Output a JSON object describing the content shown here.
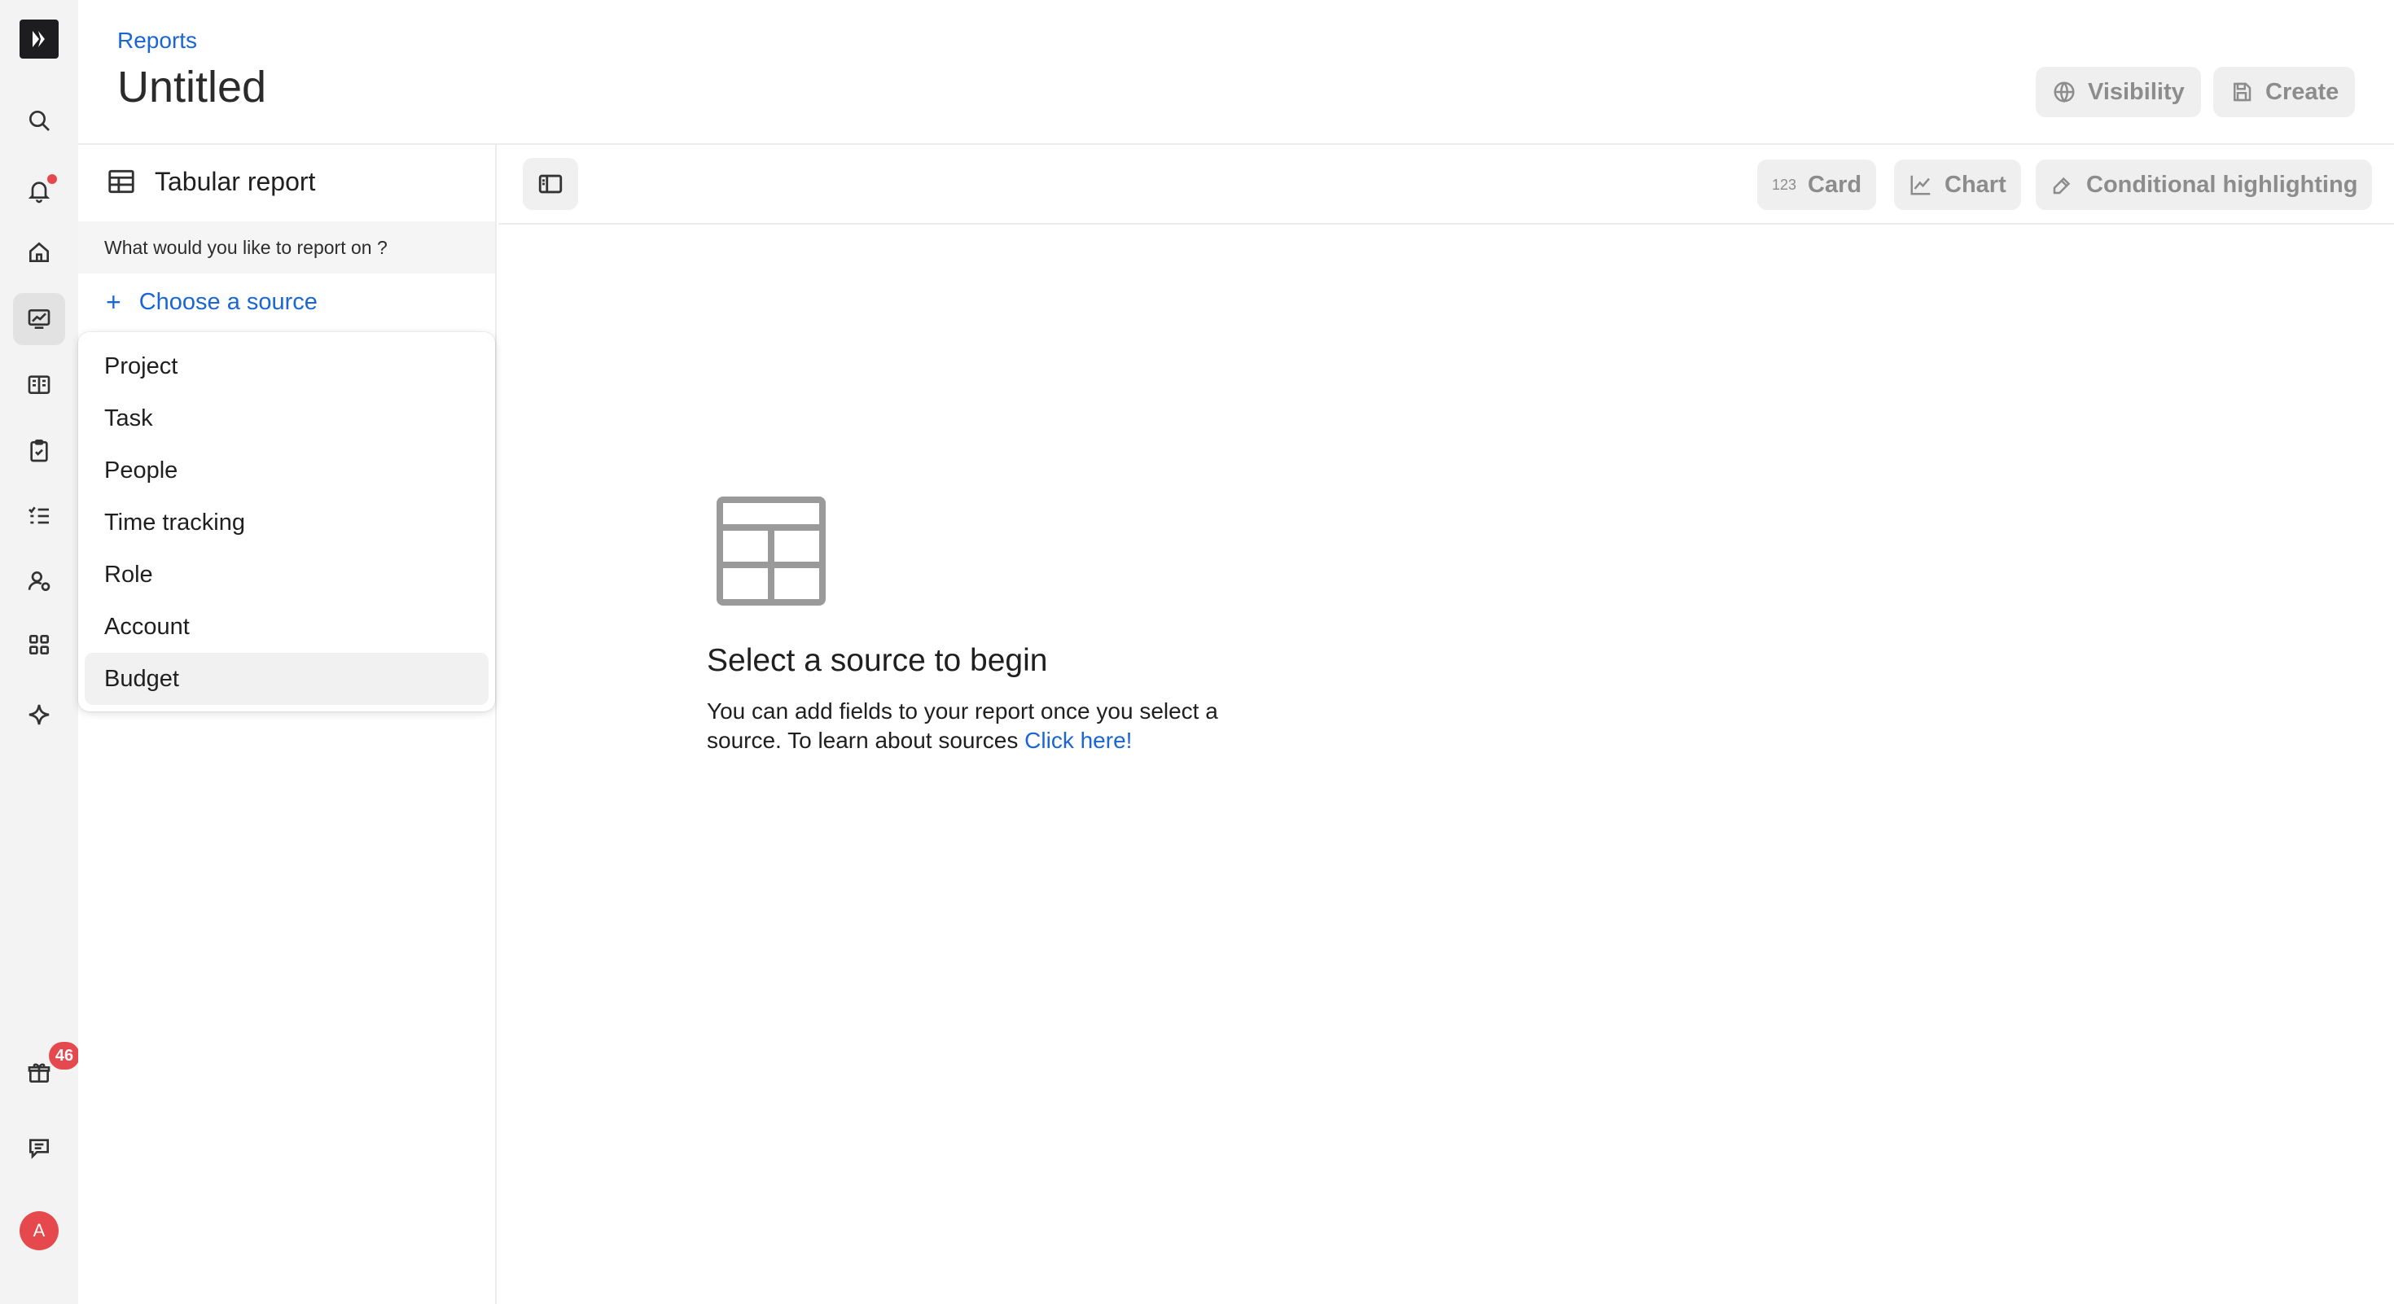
{
  "header": {
    "breadcrumb": "Reports",
    "title": "Untitled",
    "visibility_label": "Visibility",
    "create_label": "Create"
  },
  "rail": {
    "icons": [
      "logo-icon",
      "search-icon",
      "bell-icon",
      "home-icon",
      "reports-icon",
      "book-icon",
      "clipboard-icon",
      "checklist-icon",
      "user-settings-icon",
      "apps-icon",
      "sparkle-icon",
      "gift-icon",
      "chat-icon"
    ],
    "gift_badge": "46",
    "avatar_initial": "A",
    "accent": "#e5484d"
  },
  "panel": {
    "title": "Tabular report",
    "question": "What would you like to report on ?",
    "choose_source_label": "Choose a source"
  },
  "dropdown": {
    "items": [
      "Project",
      "Task",
      "People",
      "Time tracking",
      "Role",
      "Account",
      "Budget"
    ],
    "highlighted": "Budget"
  },
  "toolbar": {
    "card_icon_text": "123",
    "card_label": "Card",
    "chart_label": "Chart",
    "conditional_label": "Conditional highlighting"
  },
  "empty_state": {
    "title": "Select a source to begin",
    "text": "You can add fields to your report once you select a source. To learn about sources ",
    "link": "Click here!"
  },
  "colors": {
    "link": "#1a66d2",
    "rail_bg": "#f3f3f3",
    "badge": "#e5484d"
  }
}
